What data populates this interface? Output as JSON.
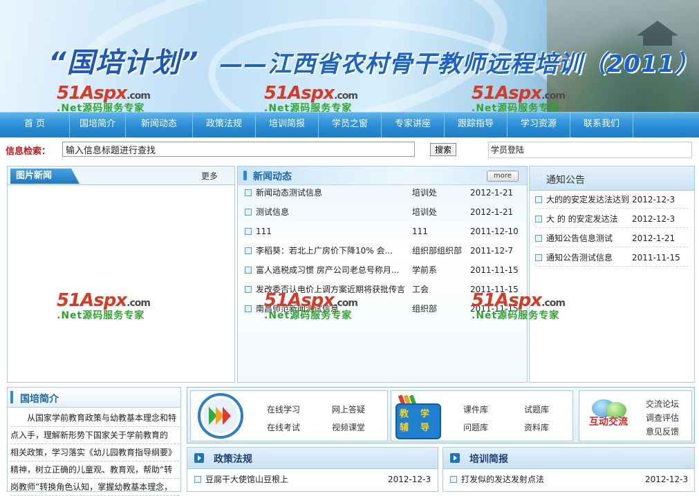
{
  "banner": {
    "title_main": "“国培计划”",
    "title_sub": "——江西省农村骨干教师远程培训（2011）"
  },
  "watermark": {
    "brand": "51Aspx",
    "domain": ".com",
    "slogan": ".Net源码服务专家"
  },
  "nav": {
    "items": [
      "首 页",
      "国培简介",
      "新闻动态",
      "政策法规",
      "培训简报",
      "学员之窗",
      "专家讲座",
      "跟踪指导",
      "学习资源",
      "联系我们"
    ]
  },
  "search": {
    "label": "信息检索：",
    "value": "输入信息标题进行查找",
    "button": "搜索"
  },
  "login": {
    "label": "学员登陆"
  },
  "pic_news": {
    "title": "图片新闻",
    "more": "更多"
  },
  "news": {
    "title": "新闻动态",
    "more": "more",
    "rows": [
      {
        "title": "新闻动态测试信息",
        "dept": "培训处",
        "date": "2012-1-21"
      },
      {
        "title": "测试信息",
        "dept": "培训处",
        "date": "2012-1-21"
      },
      {
        "title": "111",
        "dept": "111",
        "date": "2011-12-10"
      },
      {
        "title": "李稻葵：若北上广房价下降10% 会...",
        "dept": "组织部组织部",
        "date": "2011-12-7"
      },
      {
        "title": "富人逃税成习惯 房产公司老总号称月...",
        "dept": "学前系",
        "date": "2011-11-15"
      },
      {
        "title": "发改委否认电价上调方案近期将获批传言",
        "dept": "工会",
        "date": "2011-11-15"
      },
      {
        "title": "南昌师范新闻测试信息",
        "dept": "组织部",
        "date": "2011-11-15"
      }
    ]
  },
  "notice": {
    "title": "通知公告",
    "rows": [
      {
        "title": "大的的安定发达法达到",
        "date": "2012-12-3"
      },
      {
        "title": "大 的 的安定发达法",
        "date": "2012-12-3"
      },
      {
        "title": "通知公告信息测试",
        "date": "2012-1-21"
      },
      {
        "title": "通知公告测试信息",
        "date": "2011-11-15"
      }
    ]
  },
  "intro": {
    "title": "国培简介",
    "lines": [
      "从国家学前教育政策与幼教基本理念和特",
      "点入手，理解新形势下国家关于学前教育的",
      "相关政策，学习落实《幼儿园教育指导纲要》",
      "精神，树立正确的儿童观、教育观，帮助“转",
      "岗教师”转换角色认知，掌握幼教基本理念，"
    ]
  },
  "quick": {
    "group1": [
      "在线学习",
      "网上答疑",
      "在线考试",
      "视频课堂"
    ],
    "group2_badge": [
      "教",
      "学",
      "辅",
      "导"
    ],
    "group2": [
      "课件库",
      "试题库",
      "问题库",
      "资料库"
    ],
    "group3_badge": "互动交流",
    "group3": [
      "交流论坛",
      "调查评估",
      "意见反馈"
    ]
  },
  "policy": {
    "title": "政策法规",
    "rows": [
      {
        "title": "豆腐干大使馆山豆根上",
        "date": "2012-12-3"
      }
    ]
  },
  "brief": {
    "title": "培训简报",
    "rows": [
      {
        "title": "打发似的发达发射点法",
        "date": "2012-12-3"
      }
    ]
  },
  "colors": {
    "nav_bg": "#2c8fd6",
    "accent_blue": "#1967b1",
    "search_label": "#c0151d"
  }
}
